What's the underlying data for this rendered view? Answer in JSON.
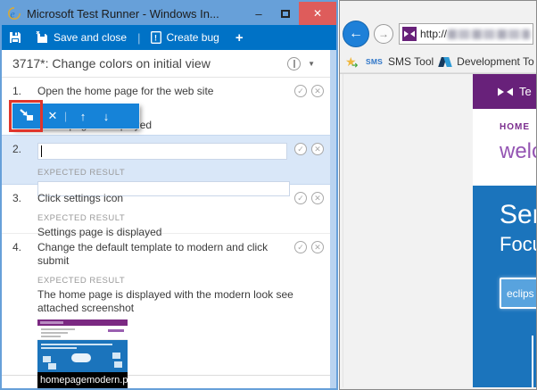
{
  "test_runner": {
    "window_title": "Microsoft Test Runner - Windows In...",
    "toolbar": {
      "save_and_close": "Save and close",
      "create_bug": "Create bug"
    },
    "header_title": "3717*: Change colors on initial view",
    "expected_result_label": "EXPECTED RESULT",
    "steps": [
      {
        "number": "1.",
        "action": "Open the home page for the web site",
        "expected": "Home page is displayed"
      },
      {
        "number": "2.",
        "action": "",
        "expected": ""
      },
      {
        "number": "3.",
        "action": "Click settings icon",
        "expected": "Settings page is displayed"
      },
      {
        "number": "4.",
        "action": "Change the default template to modern and click submit",
        "expected": "The home page is displayed with the modern look see attached screenshot",
        "attachment_name": "homepagemodern.png"
      }
    ]
  },
  "browser": {
    "address_protocol": "http://",
    "favorites": {
      "sms_icon_text": "SMS",
      "sms_label": "SMS Tool",
      "dev_label": "Development To"
    },
    "page": {
      "brand_text": "Te",
      "nav_home": "HOME",
      "welcome_text": "welc",
      "hero_line1": "Serv",
      "hero_line2": "Focu",
      "button_label": "eclips"
    }
  },
  "icons": {
    "minimize": "–",
    "close": "✕",
    "plus": "+",
    "toolbar_divider": "|",
    "pass": "✓",
    "fail": "✕",
    "delete": "✕",
    "up": "↑",
    "down": "↓",
    "caret": "▼",
    "back": "←",
    "forward": "→",
    "star": "★",
    "arrow": "➜"
  },
  "colors": {
    "titlebar_blue": "#67A0D9",
    "toolbar_blue": "#0072C6",
    "close_red": "#DE5C5B",
    "selected_step_bg": "#D9E7F8",
    "annotation_red": "#E0352B",
    "float_toolbar_blue": "#1683D8",
    "ie_back_blue": "#1E80D8",
    "vs_purple": "#68217A",
    "page_blue": "#1B74BC",
    "page_button_blue": "#58A3DE"
  }
}
